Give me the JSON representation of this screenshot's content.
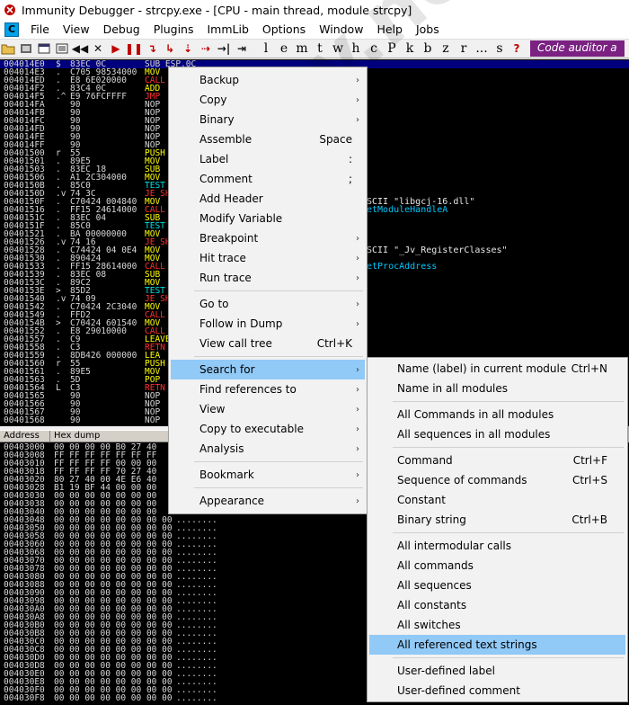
{
  "window": {
    "title": "Immunity Debugger - strcpy.exe - [CPU - main thread, module strcpy]"
  },
  "menubar": {
    "cpu_icon": "C",
    "items": [
      "File",
      "View",
      "Debug",
      "Plugins",
      "ImmLib",
      "Options",
      "Window",
      "Help",
      "Jobs"
    ]
  },
  "toolbar": {
    "letters": [
      "l",
      "e",
      "m",
      "t",
      "w",
      "h",
      "c",
      "P",
      "k",
      "b",
      "z",
      "r",
      "...",
      "s"
    ],
    "help_glyph": "?",
    "auditor_label": "Code auditor a"
  },
  "disasm": {
    "rows": [
      {
        "addr": "004014E0",
        "mark": "$",
        "hex": "83EC 0C",
        "ins": "SUB ESP,0C",
        "cls": "c-white",
        "sel": true
      },
      {
        "addr": "004014E3",
        "mark": ".",
        "hex": "C705 98534000",
        "ins": "MOV",
        "cls": "c-yellow"
      },
      {
        "addr": "004014ED",
        "mark": ".",
        "hex": "E8 6E020000",
        "ins": "CALL",
        "cls": "c-red"
      },
      {
        "addr": "004014F2",
        "mark": ".",
        "hex": "83C4 0C",
        "ins": "ADD",
        "cls": "c-yellow"
      },
      {
        "addr": "004014F5",
        "mark": ".^",
        "hex": "E9 76FCFFFF",
        "ins": "JMP",
        "cls": "c-red"
      },
      {
        "addr": "004014FA",
        "mark": "",
        "hex": "90",
        "ins": "NOP",
        "cls": "c-white"
      },
      {
        "addr": "004014FB",
        "mark": "",
        "hex": "90",
        "ins": "NOP",
        "cls": "c-white"
      },
      {
        "addr": "004014FC",
        "mark": "",
        "hex": "90",
        "ins": "NOP",
        "cls": "c-white"
      },
      {
        "addr": "004014FD",
        "mark": "",
        "hex": "90",
        "ins": "NOP",
        "cls": "c-white"
      },
      {
        "addr": "004014FE",
        "mark": "",
        "hex": "90",
        "ins": "NOP",
        "cls": "c-white"
      },
      {
        "addr": "004014FF",
        "mark": "",
        "hex": "90",
        "ins": "NOP",
        "cls": "c-white"
      },
      {
        "addr": "00401500",
        "mark": "r",
        "hex": "55",
        "ins": "PUSH",
        "cls": "c-yellow"
      },
      {
        "addr": "00401501",
        "mark": ".",
        "hex": "89E5",
        "ins": "MOV",
        "cls": "c-yellow"
      },
      {
        "addr": "00401503",
        "mark": ".",
        "hex": "83EC 18",
        "ins": "SUB",
        "cls": "c-yellow"
      },
      {
        "addr": "00401506",
        "mark": ".",
        "hex": "A1 2C304000",
        "ins": "MOV",
        "cls": "c-yellow"
      },
      {
        "addr": "0040150B",
        "mark": ".",
        "hex": "85C0",
        "ins": "TEST",
        "cls": "c-cyan"
      },
      {
        "addr": "0040150D",
        "mark": ".v",
        "hex": "74 3C",
        "ins": "JE SH",
        "cls": "c-red"
      },
      {
        "addr": "0040150F",
        "mark": ".",
        "hex": "C70424 004840",
        "ins": "MOV",
        "cls": "c-yellow"
      },
      {
        "addr": "00401516",
        "mark": ".",
        "hex": "FF15 24614000",
        "ins": "CALL",
        "cls": "c-red"
      },
      {
        "addr": "0040151C",
        "mark": ".",
        "hex": "83EC 04",
        "ins": "SUB",
        "cls": "c-yellow"
      },
      {
        "addr": "0040151F",
        "mark": ".",
        "hex": "85C0",
        "ins": "TEST",
        "cls": "c-cyan"
      },
      {
        "addr": "00401521",
        "mark": ".",
        "hex": "BA 00000000",
        "ins": "MOV",
        "cls": "c-yellow"
      },
      {
        "addr": "00401526",
        "mark": ".v",
        "hex": "74 16",
        "ins": "JE SH",
        "cls": "c-red"
      },
      {
        "addr": "00401528",
        "mark": ".",
        "hex": "C74424 04 0E4",
        "ins": "MOV",
        "cls": "c-yellow"
      },
      {
        "addr": "00401530",
        "mark": ".",
        "hex": "890424",
        "ins": "MOV",
        "cls": "c-yellow"
      },
      {
        "addr": "00401533",
        "mark": ".",
        "hex": "FF15 28614000",
        "ins": "CALL",
        "cls": "c-red"
      },
      {
        "addr": "00401539",
        "mark": ".",
        "hex": "83EC 08",
        "ins": "SUB",
        "cls": "c-yellow"
      },
      {
        "addr": "0040153C",
        "mark": ".",
        "hex": "89C2",
        "ins": "MOV",
        "cls": "c-yellow"
      },
      {
        "addr": "0040153E",
        "mark": ">",
        "hex": "85D2",
        "ins": "TEST",
        "cls": "c-cyan"
      },
      {
        "addr": "00401540",
        "mark": ".v",
        "hex": "74 09",
        "ins": "JE SH",
        "cls": "c-red"
      },
      {
        "addr": "00401542",
        "mark": ".",
        "hex": "C70424 2C3040",
        "ins": "MOV",
        "cls": "c-yellow"
      },
      {
        "addr": "00401549",
        "mark": ".",
        "hex": "FFD2",
        "ins": "CALL",
        "cls": "c-red"
      },
      {
        "addr": "0040154B",
        "mark": ">",
        "hex": "C70424 601540",
        "ins": "MOV",
        "cls": "c-yellow"
      },
      {
        "addr": "00401552",
        "mark": ".",
        "hex": "E8 29010000",
        "ins": "CALL",
        "cls": "c-red"
      },
      {
        "addr": "00401557",
        "mark": ".",
        "hex": "C9",
        "ins": "LEAVE",
        "cls": "c-yellow"
      },
      {
        "addr": "00401558",
        "mark": ".",
        "hex": "C3",
        "ins": "RETN",
        "cls": "c-red"
      },
      {
        "addr": "00401559",
        "mark": ".",
        "hex": "8DB426 000000",
        "ins": "LEA",
        "cls": "c-yellow"
      },
      {
        "addr": "00401560",
        "mark": "r",
        "hex": "55",
        "ins": "PUSH",
        "cls": "c-yellow"
      },
      {
        "addr": "00401561",
        "mark": ".",
        "hex": "89E5",
        "ins": "MOV",
        "cls": "c-yellow"
      },
      {
        "addr": "00401563",
        "mark": ".",
        "hex": "5D",
        "ins": "POP",
        "cls": "c-yellow"
      },
      {
        "addr": "00401564",
        "mark": "L",
        "hex": "C3",
        "ins": "RETN",
        "cls": "c-red"
      },
      {
        "addr": "00401565",
        "mark": "",
        "hex": "90",
        "ins": "NOP",
        "cls": "c-white"
      },
      {
        "addr": "00401566",
        "mark": "",
        "hex": "90",
        "ins": "NOP",
        "cls": "c-white"
      },
      {
        "addr": "00401567",
        "mark": "",
        "hex": "90",
        "ins": "NOP",
        "cls": "c-white"
      },
      {
        "addr": "00401568",
        "mark": "",
        "hex": "90",
        "ins": "NOP",
        "cls": "c-white"
      }
    ],
    "comments": [
      {
        "row": 17,
        "text": "SCII \"libgcj-16.dll\"",
        "cls": ""
      },
      {
        "row": 18,
        "text": "etModuleHandleA",
        "cls": "cyan"
      },
      {
        "row": 23,
        "text": "SCII \"_Jv_RegisterClasses\"",
        "cls": ""
      },
      {
        "row": 25,
        "text": "etProcAddress",
        "cls": "cyan"
      }
    ]
  },
  "dump": {
    "headers": [
      "Address",
      "Hex dump"
    ],
    "rows": [
      {
        "addr": "00403000",
        "hex": "00 00 00 00 B0 27 40",
        "txt": ""
      },
      {
        "addr": "00403008",
        "hex": "FF FF FF FF FF FF FF",
        "txt": ""
      },
      {
        "addr": "00403010",
        "hex": "FF FF FF FF 00 00 00",
        "txt": ""
      },
      {
        "addr": "00403018",
        "hex": "FF FF FF FF 70 27 40",
        "txt": ""
      },
      {
        "addr": "00403020",
        "hex": "80 27 40 00 4E E6 40",
        "txt": ""
      },
      {
        "addr": "00403028",
        "hex": "B1 19 BF 44 00 00 00",
        "txt": ""
      },
      {
        "addr": "00403030",
        "hex": "00 00 00 00 00 00 00",
        "txt": ""
      },
      {
        "addr": "00403038",
        "hex": "00 00 00 00 00 00 00",
        "txt": ""
      },
      {
        "addr": "00403040",
        "hex": "00 00 00 00 00 00 00",
        "txt": ""
      },
      {
        "addr": "00403048",
        "hex": "00 00 00 00 00 00 00 00",
        "txt": "........"
      },
      {
        "addr": "00403050",
        "hex": "00 00 00 00 00 00 00 00",
        "txt": "........"
      },
      {
        "addr": "00403058",
        "hex": "00 00 00 00 00 00 00 00",
        "txt": "........"
      },
      {
        "addr": "00403060",
        "hex": "00 00 00 00 00 00 00 00",
        "txt": "........"
      },
      {
        "addr": "00403068",
        "hex": "00 00 00 00 00 00 00 00",
        "txt": "........"
      },
      {
        "addr": "00403070",
        "hex": "00 00 00 00 00 00 00 00",
        "txt": "........"
      },
      {
        "addr": "00403078",
        "hex": "00 00 00 00 00 00 00 00",
        "txt": "........"
      },
      {
        "addr": "00403080",
        "hex": "00 00 00 00 00 00 00 00",
        "txt": "........"
      },
      {
        "addr": "00403088",
        "hex": "00 00 00 00 00 00 00 00",
        "txt": "........"
      },
      {
        "addr": "00403090",
        "hex": "00 00 00 00 00 00 00 00",
        "txt": "........"
      },
      {
        "addr": "00403098",
        "hex": "00 00 00 00 00 00 00 00",
        "txt": "........"
      },
      {
        "addr": "004030A0",
        "hex": "00 00 00 00 00 00 00 00",
        "txt": "........"
      },
      {
        "addr": "004030A8",
        "hex": "00 00 00 00 00 00 00 00",
        "txt": "........"
      },
      {
        "addr": "004030B0",
        "hex": "00 00 00 00 00 00 00 00",
        "txt": "........"
      },
      {
        "addr": "004030B8",
        "hex": "00 00 00 00 00 00 00 00",
        "txt": "........"
      },
      {
        "addr": "004030C0",
        "hex": "00 00 00 00 00 00 00 00",
        "txt": "........"
      },
      {
        "addr": "004030C8",
        "hex": "00 00 00 00 00 00 00 00",
        "txt": "........"
      },
      {
        "addr": "004030D0",
        "hex": "00 00 00 00 00 00 00 00",
        "txt": "........"
      },
      {
        "addr": "004030D8",
        "hex": "00 00 00 00 00 00 00 00",
        "txt": "........"
      },
      {
        "addr": "004030E0",
        "hex": "00 00 00 00 00 00 00 00",
        "txt": "........"
      },
      {
        "addr": "004030E8",
        "hex": "00 00 00 00 00 00 00 00",
        "txt": "........"
      },
      {
        "addr": "004030F0",
        "hex": "00 00 00 00 00 00 00 00",
        "txt": "........"
      },
      {
        "addr": "004030F8",
        "hex": "00 00 00 00 00 00 00 00",
        "txt": "........"
      }
    ]
  },
  "context_menu": {
    "items": [
      {
        "label": "Backup",
        "shortcut": "",
        "submenu": true
      },
      {
        "label": "Copy",
        "shortcut": "",
        "submenu": true
      },
      {
        "label": "Binary",
        "shortcut": "",
        "submenu": true
      },
      {
        "label": "Assemble",
        "shortcut": "Space",
        "submenu": false
      },
      {
        "label": "Label",
        "shortcut": ":",
        "submenu": false
      },
      {
        "label": "Comment",
        "shortcut": ";",
        "submenu": false
      },
      {
        "label": "Add Header",
        "shortcut": "",
        "submenu": false
      },
      {
        "label": "Modify Variable",
        "shortcut": "",
        "submenu": false
      },
      {
        "label": "Breakpoint",
        "shortcut": "",
        "submenu": true
      },
      {
        "label": "Hit trace",
        "shortcut": "",
        "submenu": true
      },
      {
        "label": "Run trace",
        "shortcut": "",
        "submenu": true
      },
      {
        "label": "Go to",
        "shortcut": "",
        "submenu": true
      },
      {
        "label": "Follow in Dump",
        "shortcut": "",
        "submenu": true
      },
      {
        "label": "View call tree",
        "shortcut": "Ctrl+K",
        "submenu": false
      },
      {
        "label": "Search for",
        "shortcut": "",
        "submenu": true,
        "highlight": true
      },
      {
        "label": "Find references to",
        "shortcut": "",
        "submenu": true
      },
      {
        "label": "View",
        "shortcut": "",
        "submenu": true
      },
      {
        "label": "Copy to executable",
        "shortcut": "",
        "submenu": true
      },
      {
        "label": "Analysis",
        "shortcut": "",
        "submenu": true
      },
      {
        "label": "Bookmark",
        "shortcut": "",
        "submenu": true
      },
      {
        "label": "Appearance",
        "shortcut": "",
        "submenu": true
      }
    ]
  },
  "search_submenu": {
    "items": [
      {
        "label": "Name (label) in current module",
        "shortcut": "Ctrl+N"
      },
      {
        "label": "Name in all modules",
        "shortcut": ""
      },
      {
        "label": "All Commands in all modules",
        "shortcut": ""
      },
      {
        "label": "All sequences in all modules",
        "shortcut": ""
      },
      {
        "label": "Command",
        "shortcut": "Ctrl+F"
      },
      {
        "label": "Sequence of commands",
        "shortcut": "Ctrl+S"
      },
      {
        "label": "Constant",
        "shortcut": ""
      },
      {
        "label": "Binary string",
        "shortcut": "Ctrl+B"
      },
      {
        "label": "All intermodular calls",
        "shortcut": ""
      },
      {
        "label": "All commands",
        "shortcut": ""
      },
      {
        "label": "All sequences",
        "shortcut": ""
      },
      {
        "label": "All constants",
        "shortcut": ""
      },
      {
        "label": "All switches",
        "shortcut": ""
      },
      {
        "label": "All referenced text strings",
        "shortcut": "",
        "highlight": true
      },
      {
        "label": "User-defined label",
        "shortcut": ""
      },
      {
        "label": "User-defined comment",
        "shortcut": ""
      }
    ]
  },
  "watermark": {
    "text": "ossby.net"
  }
}
